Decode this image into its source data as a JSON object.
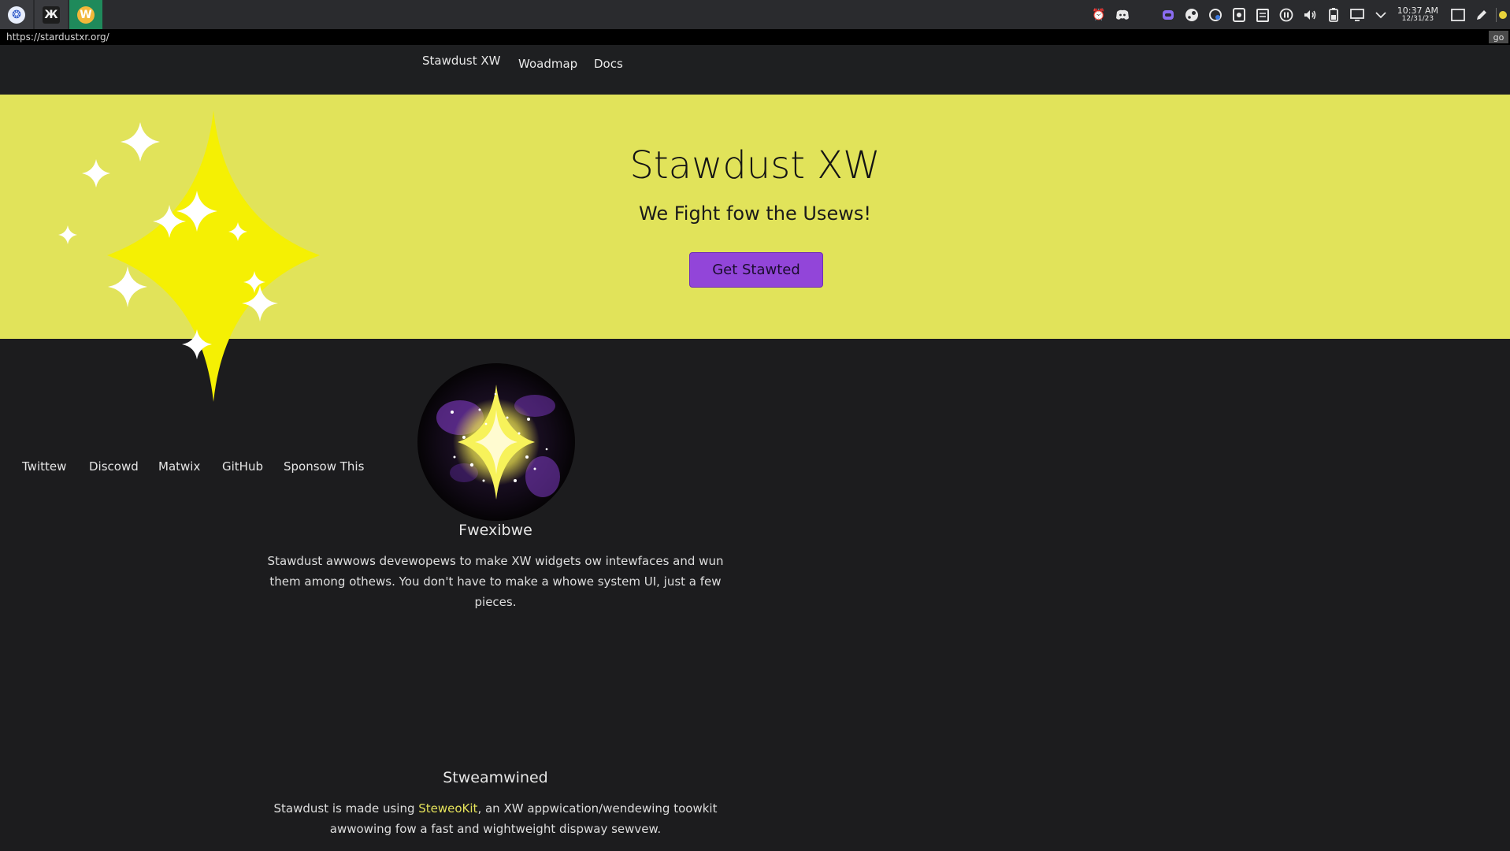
{
  "taskbar": {
    "apps": [
      {
        "icon": "app-launcher-icon",
        "glyph": "❂"
      },
      {
        "icon": "terminal-app-icon",
        "glyph": "Ж"
      },
      {
        "icon": "browser-app-icon",
        "glyph": "W"
      }
    ],
    "clock": {
      "time": "10:37 AM",
      "date": "12/31/23"
    }
  },
  "urlbar": {
    "url": "https://stardustxr.org/",
    "go_label": "go"
  },
  "nav": {
    "brand": "Stawdust XW",
    "roadmap": "Woadmap",
    "docs": "Docs"
  },
  "hero": {
    "title": "Stawdust XW",
    "subtitle": "We Fight fow the Usews!",
    "cta_label": "Get Stawted",
    "background_color": "#e1e35a",
    "cta_color": "#9245d9"
  },
  "social": {
    "twitter": "Twittew",
    "discord": "Discowd",
    "matrix": "Matwix",
    "github": "GitHub",
    "sponsor": "Sponsow This"
  },
  "sections": {
    "flexible": {
      "title": "Fwexibwe",
      "text": "Stawdust awwows devewopews to make XW widgets ow intewfaces and wun them among othews. You don't have to make a whowe system UI, just a few pieces."
    },
    "streamlined": {
      "title": "Stweamwined",
      "text_before": "Stawdust is made using ",
      "link": "SteweoKit",
      "text_after": ", an XW appwication/wendewing toowkit awwowing fow a fast and wightweight dispway sewvew.",
      "link_color": "#e5e25a"
    }
  }
}
